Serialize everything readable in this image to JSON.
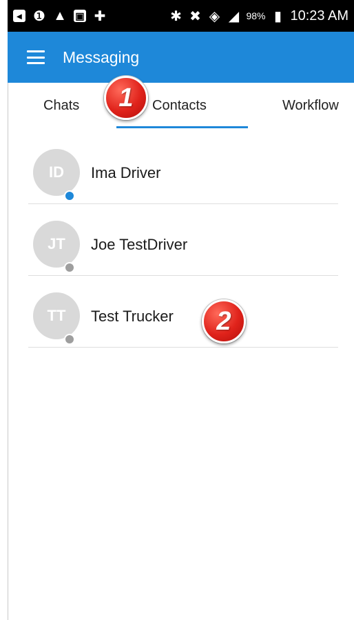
{
  "status_bar": {
    "icons_left": [
      "notification-icon",
      "alert-icon",
      "warning-icon",
      "image-icon",
      "add-icon"
    ],
    "icons_right": [
      "bluetooth-icon",
      "mute-icon",
      "wifi-icon",
      "signal-icon",
      "battery-icon"
    ],
    "battery_percent": "98%",
    "time": "10:23 AM"
  },
  "app_bar": {
    "title": "Messaging",
    "color": "#1e88d9"
  },
  "tabs": [
    {
      "label": "Chats",
      "active": false
    },
    {
      "label": "Contacts",
      "active": true
    },
    {
      "label": "Workflow",
      "active": false
    }
  ],
  "contacts": [
    {
      "initials": "ID",
      "name": "Ima Driver",
      "status": "online"
    },
    {
      "initials": "JT",
      "name": "Joe TestDriver",
      "status": "offline"
    },
    {
      "initials": "TT",
      "name": "Test Trucker",
      "status": "offline"
    }
  ],
  "callouts": [
    "1",
    "2"
  ],
  "colors": {
    "accent": "#1e88d9",
    "presence_online": "#1e88d9",
    "presence_offline": "#9e9e9e",
    "callout": "#e0231b"
  }
}
